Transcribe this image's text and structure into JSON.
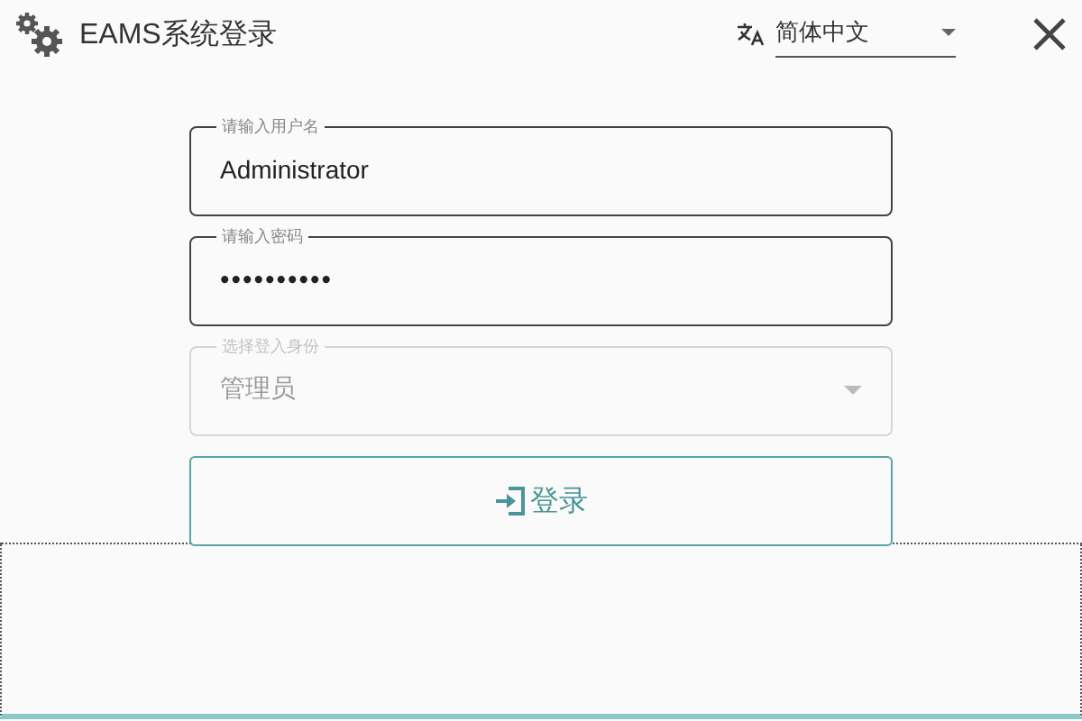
{
  "window": {
    "title": "EAMS系统登录"
  },
  "language": {
    "value": "简体中文"
  },
  "fields": [
    {
      "kind": "text",
      "label": "请输入用户名",
      "value": "Administrator",
      "disabled": false
    },
    {
      "kind": "password",
      "label": "请输入密码",
      "value": "••••••••••",
      "disabled": false
    },
    {
      "kind": "select",
      "label": "选择登入身份",
      "value": "管理员",
      "disabled": true
    }
  ],
  "login_button": {
    "label": "登录"
  }
}
